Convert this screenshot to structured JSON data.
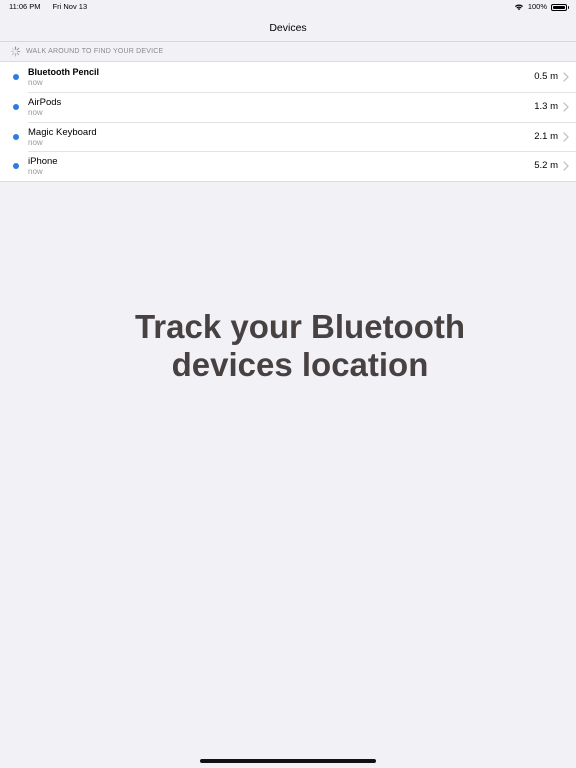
{
  "status_bar": {
    "time": "11:06 PM",
    "date": "Fri Nov 13",
    "battery": "100%",
    "icons": [
      "wifi-icon",
      "battery-icon"
    ]
  },
  "nav": {
    "title": "Devices"
  },
  "section": {
    "header": "WALK AROUND TO FIND YOUR DEVICE",
    "icon": "spinner-icon"
  },
  "devices": [
    {
      "name": "Bluetooth Pencil",
      "seen": "now",
      "distance": "0.5 m"
    },
    {
      "name": "AirPods",
      "seen": "now",
      "distance": "1.3 m"
    },
    {
      "name": "Magic Keyboard",
      "seen": "now",
      "distance": "2.1 m"
    },
    {
      "name": "iPhone",
      "seen": "now",
      "distance": "5.2 m"
    }
  ],
  "colors": {
    "accent_dot": "#2f7be0",
    "background": "#f2f1f6",
    "headline": "#474142"
  },
  "headline": {
    "line1": "Track your Bluetooth",
    "line2": "devices location"
  }
}
